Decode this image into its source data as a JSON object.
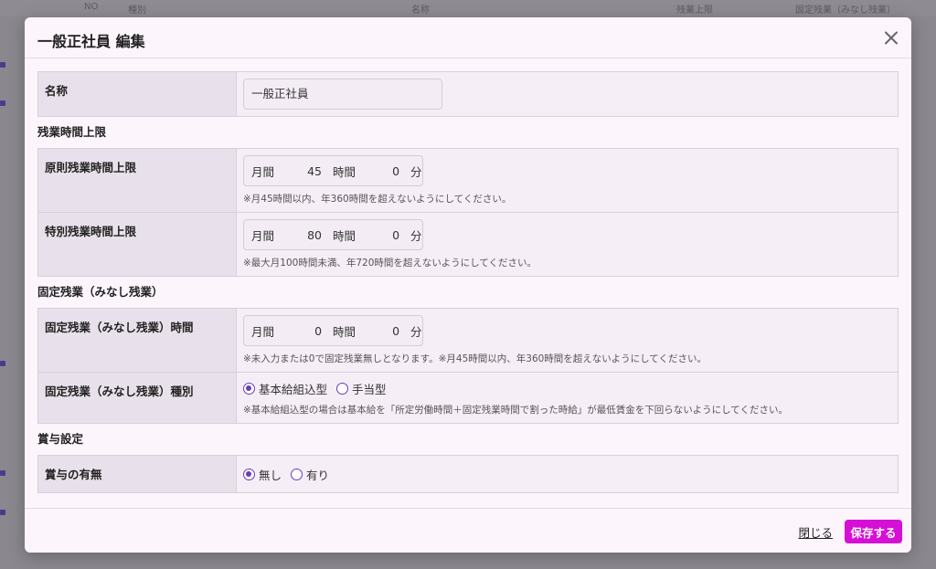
{
  "background": {
    "header_cols": [
      "NO",
      "種別",
      "名称",
      "残業上限",
      "固定残業（みなし残業）"
    ]
  },
  "modal": {
    "title": "一般正社員 編集",
    "name_label": "名称",
    "name_value": "一般正社員",
    "section_overtime": "残業時間上限",
    "principal_label": "原則残業時間上限",
    "principal": {
      "month": "月間",
      "hours": "45",
      "hour_unit": "時間",
      "minutes": "0",
      "minute_unit": "分"
    },
    "principal_note": "※月45時間以内、年360時間を超えないようにしてください。",
    "special_label": "特別残業時間上限",
    "special": {
      "month": "月間",
      "hours": "80",
      "hour_unit": "時間",
      "minutes": "0",
      "minute_unit": "分"
    },
    "special_note": "※最大月100時間未満、年720時間を超えないようにしてください。",
    "section_fixed": "固定残業（みなし残業）",
    "fixed_time_label": "固定残業（みなし残業）時間",
    "fixed_time": {
      "month": "月間",
      "hours": "0",
      "hour_unit": "時間",
      "minutes": "0",
      "minute_unit": "分"
    },
    "fixed_time_note": "※未入力または0で固定残業無しとなります。※月45時間以内、年360時間を超えないようにしてください。",
    "fixed_type_label": "固定残業（みなし残業）種別",
    "fixed_type_options": [
      "基本給組込型",
      "手当型"
    ],
    "fixed_type_selected": "基本給組込型",
    "fixed_type_note": "※基本給組込型の場合は基本給を「所定労働時間＋固定残業時間で割った時給」が最低賃金を下回らないようにしてください。",
    "section_bonus": "賞与設定",
    "bonus_label": "賞与の有無",
    "bonus_options": [
      "無し",
      "有り"
    ],
    "bonus_selected": "無し",
    "close_label": "閉じる",
    "save_label": "保存する"
  },
  "colors": {
    "accent": "#d60fd6",
    "radio": "#6a3bbf"
  }
}
